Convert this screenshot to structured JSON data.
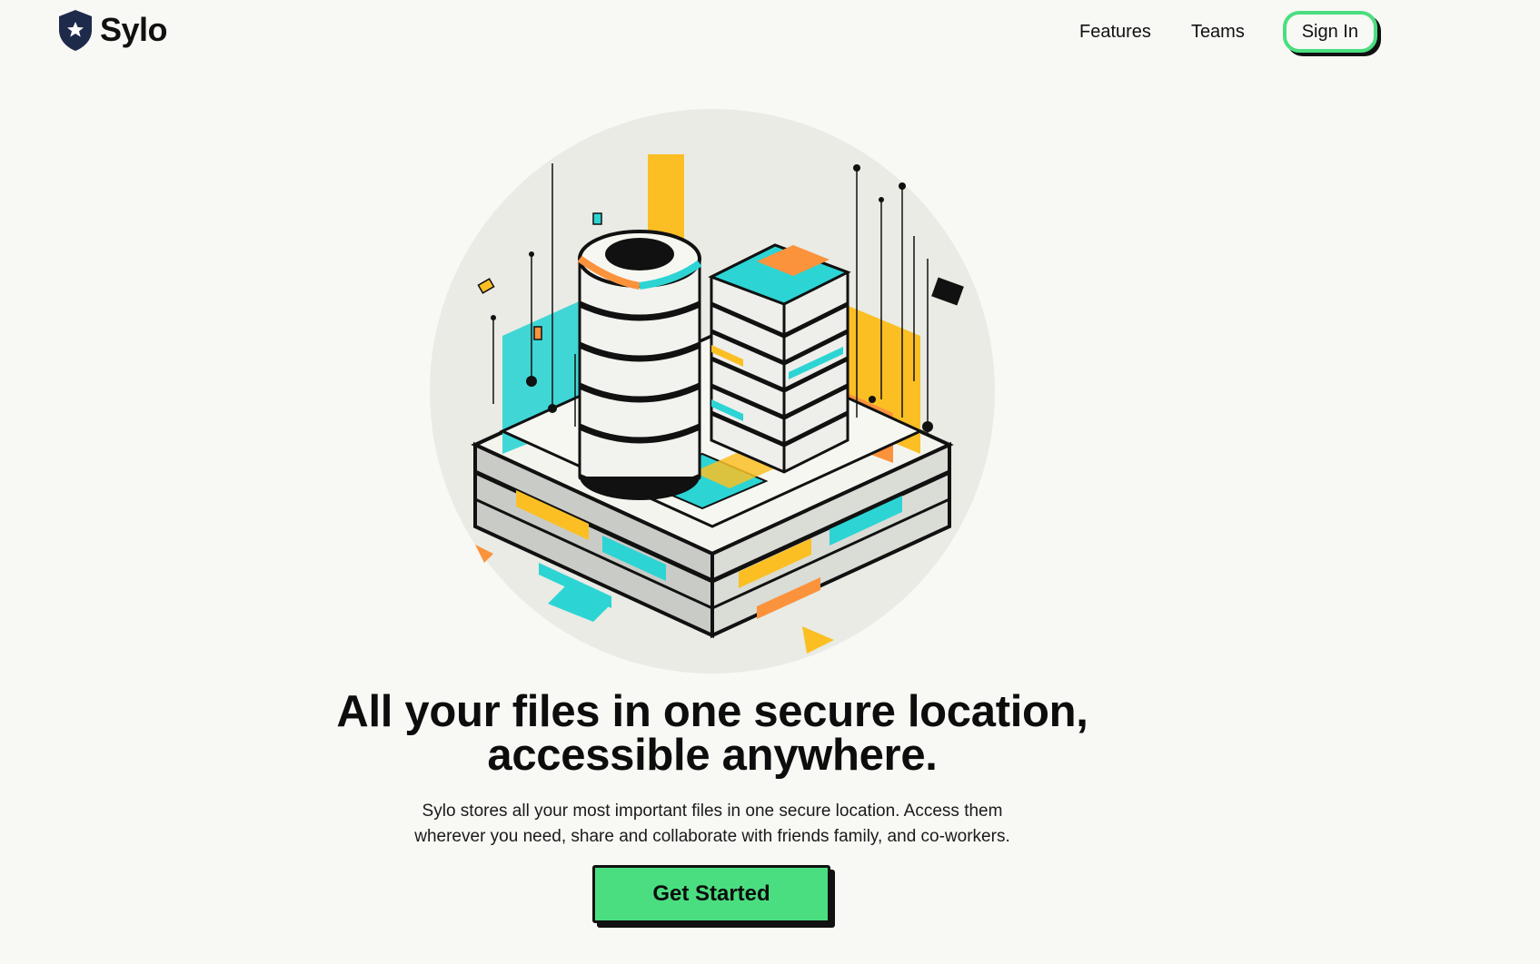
{
  "brand": {
    "name": "Sylo",
    "logo_icon": "shield-star-icon",
    "accent_color": "#4ade80"
  },
  "nav": {
    "features_label": "Features",
    "teams_label": "Teams",
    "signin_label": "Sign In"
  },
  "hero": {
    "illustration": "isometric-server-building-illustration",
    "headline_line1": "All your files in one secure location,",
    "headline_line2": "accessible anywhere.",
    "subtext_line1": "Sylo stores all your most important files in one secure location. Access them",
    "subtext_line2": "wherever you need, share and collaborate with friends family, and co-workers.",
    "cta_label": "Get Started"
  }
}
